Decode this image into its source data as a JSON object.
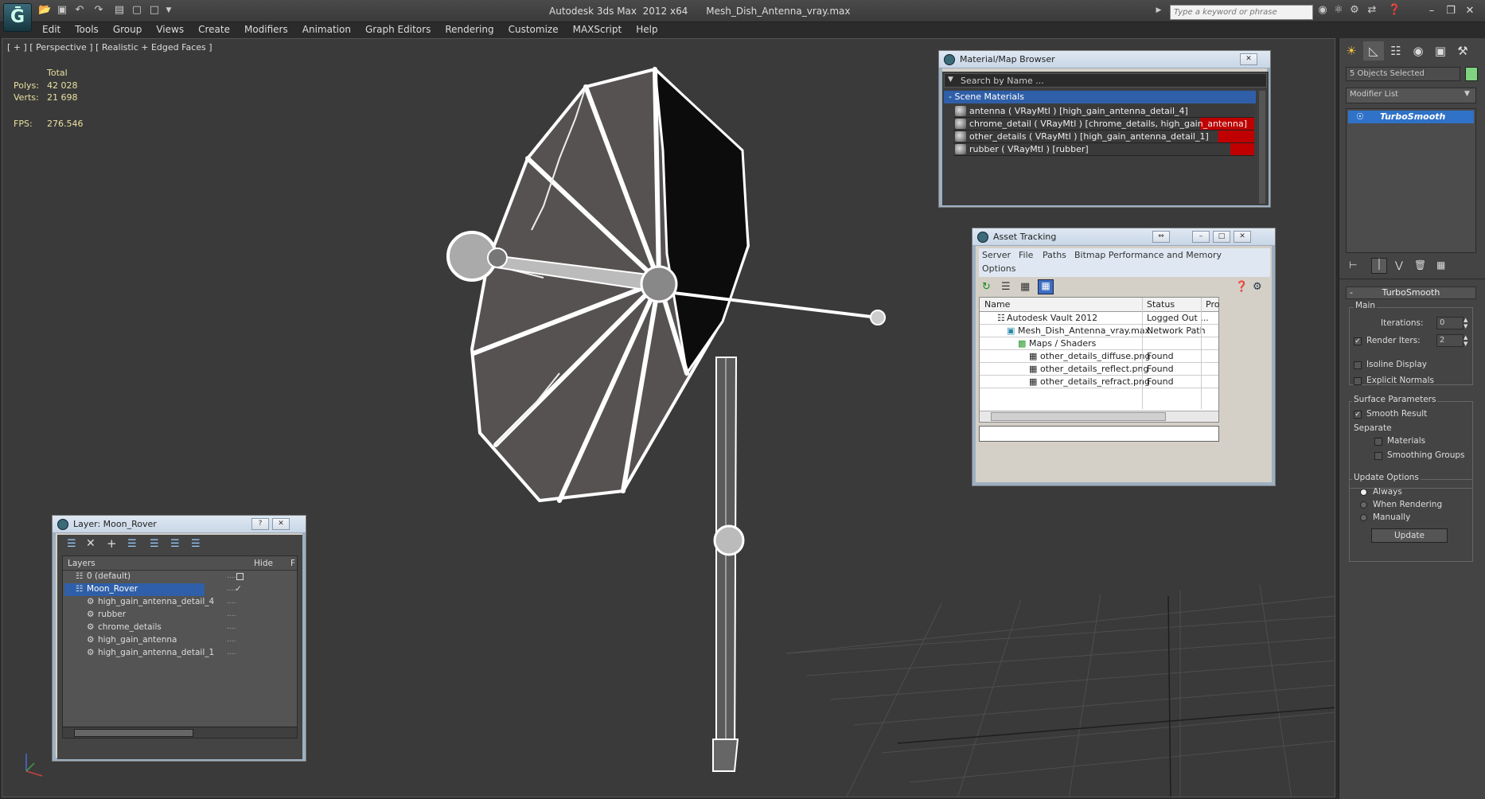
{
  "app": {
    "title": "Autodesk 3ds Max  2012 x64      Mesh_Dish_Antenna_vray.max",
    "logo_icon": "3ds-max-logo-icon",
    "search_placeholder": "Type a keyword or phrase"
  },
  "menu": [
    "Edit",
    "Tools",
    "Group",
    "Views",
    "Create",
    "Modifiers",
    "Animation",
    "Graph Editors",
    "Rendering",
    "Customize",
    "MAXScript",
    "Help"
  ],
  "viewport": {
    "label": "[ + ] [ Perspective ] [ Realistic + Edged Faces ]",
    "stats": {
      "total_label": "Total",
      "polys_label": "Polys:",
      "polys_value": "42 028",
      "verts_label": "Verts:",
      "verts_value": "21 698",
      "fps_label": "FPS:",
      "fps_value": "276.546"
    }
  },
  "command_panel": {
    "selection": "5 Objects Selected",
    "modifier_list": "Modifier List",
    "stack_item": "TurboSmooth",
    "rollout_title": "TurboSmooth",
    "main_label": "Main",
    "iterations_label": "Iterations:",
    "iterations_value": "0",
    "render_iters_label": "Render Iters:",
    "render_iters_value": "2",
    "isoline_label": "Isoline Display",
    "explicit_normals_label": "Explicit Normals",
    "surface_params_label": "Surface Parameters",
    "smooth_result_label": "Smooth Result",
    "separate_label": "Separate",
    "materials_label": "Materials",
    "smoothing_groups_label": "Smoothing Groups",
    "update_options_label": "Update Options",
    "always_label": "Always",
    "when_rendering_label": "When Rendering",
    "manually_label": "Manually",
    "update_button": "Update"
  },
  "material_browser": {
    "title": "Material/Map Browser",
    "search_placeholder": "Search by Name ...",
    "group_label": "Scene Materials",
    "items": [
      {
        "label": "antenna  ( VRayMtl ) [high_gain_antenna_detail_4]"
      },
      {
        "label": "chrome_detail  ( VRayMtl ) [chrome_details, high_gain_antenna]"
      },
      {
        "label": "other_details  ( VRayMtl ) [high_gain_antenna_detail_1]"
      },
      {
        "label": "rubber  ( VRayMtl ) [rubber]"
      }
    ],
    "highlight_color": "#c00000"
  },
  "asset_tracking": {
    "title": "Asset Tracking",
    "menu": [
      "Server",
      "File",
      "Paths",
      "Bitmap Performance and Memory",
      "Options"
    ],
    "columns": {
      "name": "Name",
      "status": "Status",
      "pro": "Pro"
    },
    "rows": [
      {
        "name": "Autodesk Vault 2012",
        "status": "Logged Out ..."
      },
      {
        "name": "Mesh_Dish_Antenna_vray.max",
        "status": "Network Path"
      },
      {
        "name": "Maps / Shaders",
        "status": ""
      },
      {
        "name": "other_details_diffuse.png",
        "status": "Found"
      },
      {
        "name": "other_details_reflect.png",
        "status": "Found"
      },
      {
        "name": "other_details_refract.png",
        "status": "Found"
      }
    ]
  },
  "layers": {
    "title": "Layer: Moon_Rover",
    "col_layers": "Layers",
    "col_hide": "Hide",
    "col_f": "F",
    "rows": [
      {
        "label": "0 (default)"
      },
      {
        "label": "Moon_Rover"
      },
      {
        "label": "high_gain_antenna_detail_4"
      },
      {
        "label": "rubber"
      },
      {
        "label": "chrome_details"
      },
      {
        "label": "high_gain_antenna"
      },
      {
        "label": "high_gain_antenna_detail_1"
      }
    ]
  }
}
